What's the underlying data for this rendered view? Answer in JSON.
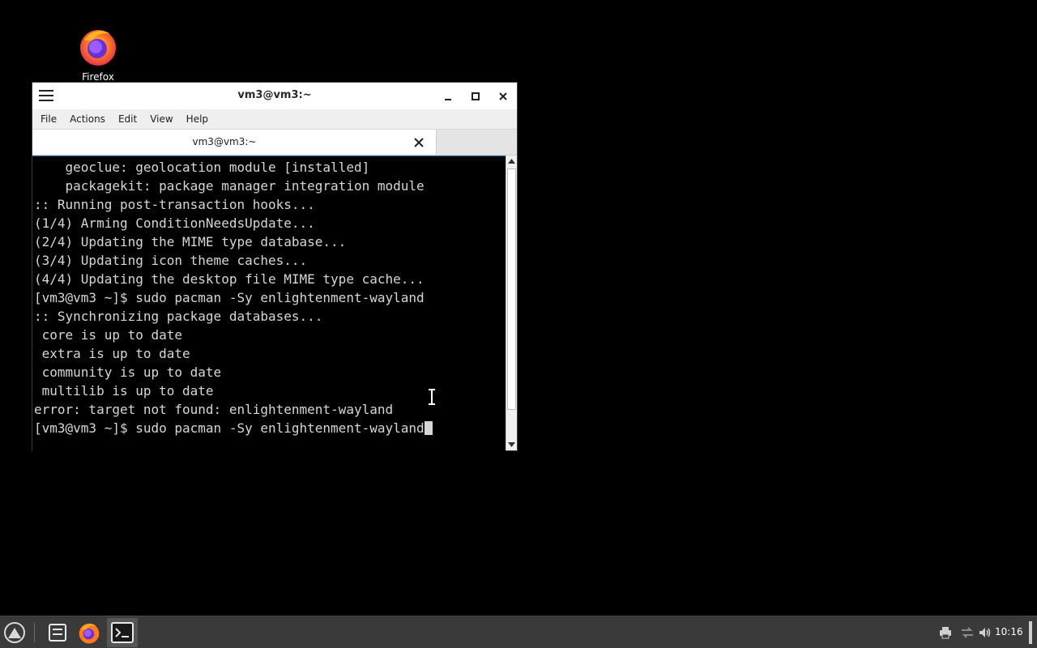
{
  "desktop": {
    "icons": [
      {
        "label": "Firefox",
        "icon": "firefox-icon"
      }
    ]
  },
  "window": {
    "title": "vm3@vm3:~",
    "menu": [
      "File",
      "Actions",
      "Edit",
      "View",
      "Help"
    ],
    "tab": {
      "title": "vm3@vm3:~"
    },
    "terminal_lines": [
      "    geoclue: geolocation module [installed]",
      "    packagekit: package manager integration module",
      ":: Running post-transaction hooks...",
      "(1/4) Arming ConditionNeedsUpdate...",
      "(2/4) Updating the MIME type database...",
      "(3/4) Updating icon theme caches...",
      "(4/4) Updating the desktop file MIME type cache...",
      "[vm3@vm3 ~]$ sudo pacman -Sy enlightenment-wayland",
      ":: Synchronizing package databases...",
      " core is up to date",
      " extra is up to date",
      " community is up to date",
      " multilib is up to date",
      "error: target not found: enlightenment-wayland",
      "[vm3@vm3 ~]$ sudo pacman -Sy enlightenment-wayland"
    ]
  },
  "taskbar": {
    "clock": "10:16",
    "apps": [
      "app-menu-icon",
      "file-manager-icon",
      "firefox-icon",
      "terminal-icon"
    ],
    "tray": [
      "printer-icon",
      "network-icon",
      "volume-icon"
    ]
  },
  "colors": {
    "desktop_bg": "#000000",
    "taskbar_bg": "#3a3a3a",
    "terminal_bg": "#000000",
    "terminal_fg": "#d6d6d6"
  }
}
